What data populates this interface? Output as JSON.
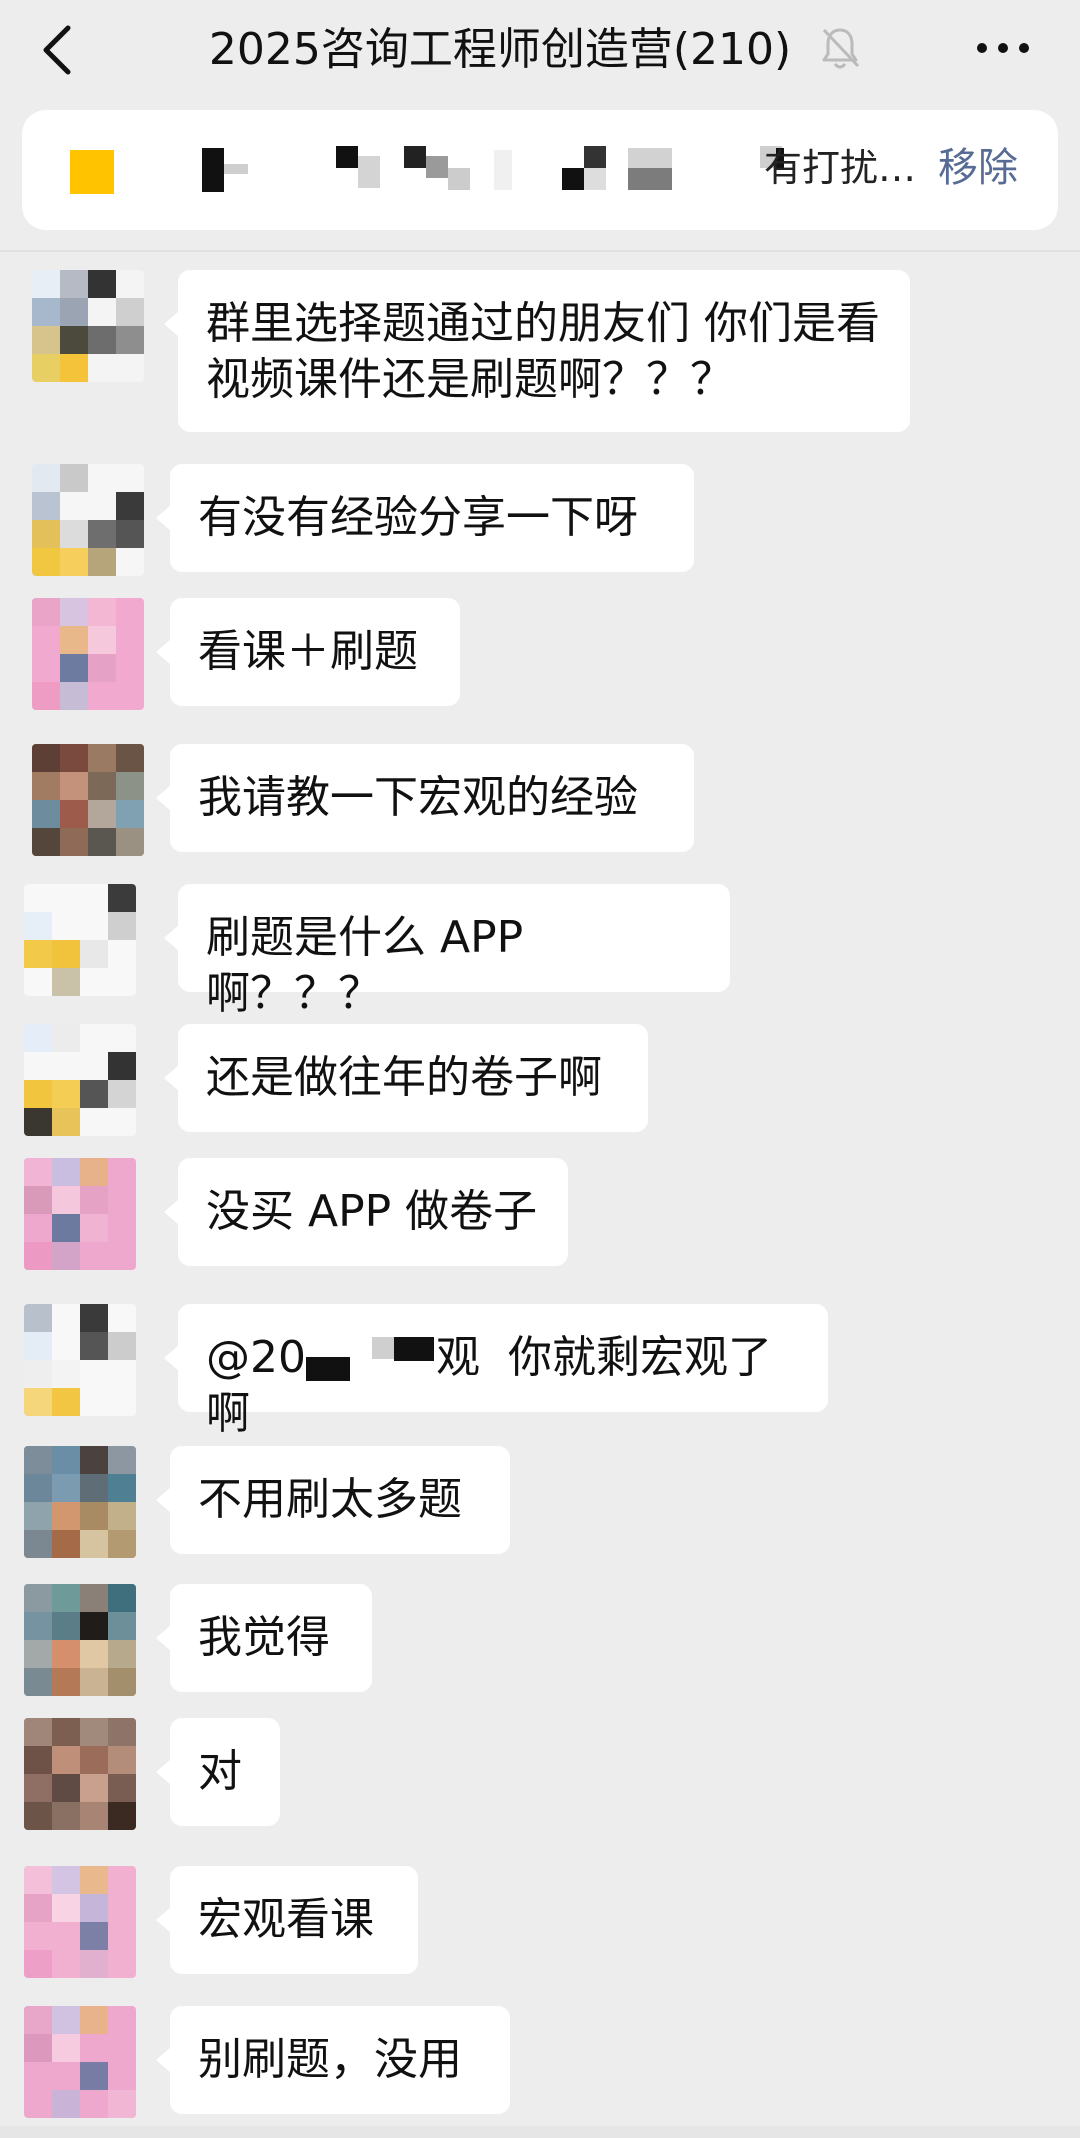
{
  "header": {
    "title": "2025咨询工程师创造营(210)",
    "back_icon": "chevron-left-icon",
    "mute_icon": "bell-off-icon",
    "more_icon": "ellipsis-icon"
  },
  "notice": {
    "text": "有打扰…",
    "action_label": "移除"
  },
  "messages": [
    {
      "text": "群里选择题通过的朋友们 你们是看\n视频课件还是刷题啊？？？"
    },
    {
      "text": "有没有经验分享一下呀"
    },
    {
      "text": "看课＋刷题"
    },
    {
      "text": "我请教一下宏观的经验"
    },
    {
      "text": "刷题是什么 APP 啊？？？"
    },
    {
      "text": "还是做往年的卷子啊"
    },
    {
      "text": "没买 APP 做卷子"
    },
    {
      "text_prefix": "@20",
      "text_suffix": "观  你就剩宏观了啊"
    },
    {
      "text": "不用刷太多题"
    },
    {
      "text": "我觉得"
    },
    {
      "text": "对"
    },
    {
      "text": "宏观看课"
    },
    {
      "text": "别刷题，没用"
    }
  ],
  "colors": {
    "background": "#ededed",
    "bubble": "#ffffff",
    "link": "#576b95",
    "notice_square": "#ffc300"
  }
}
